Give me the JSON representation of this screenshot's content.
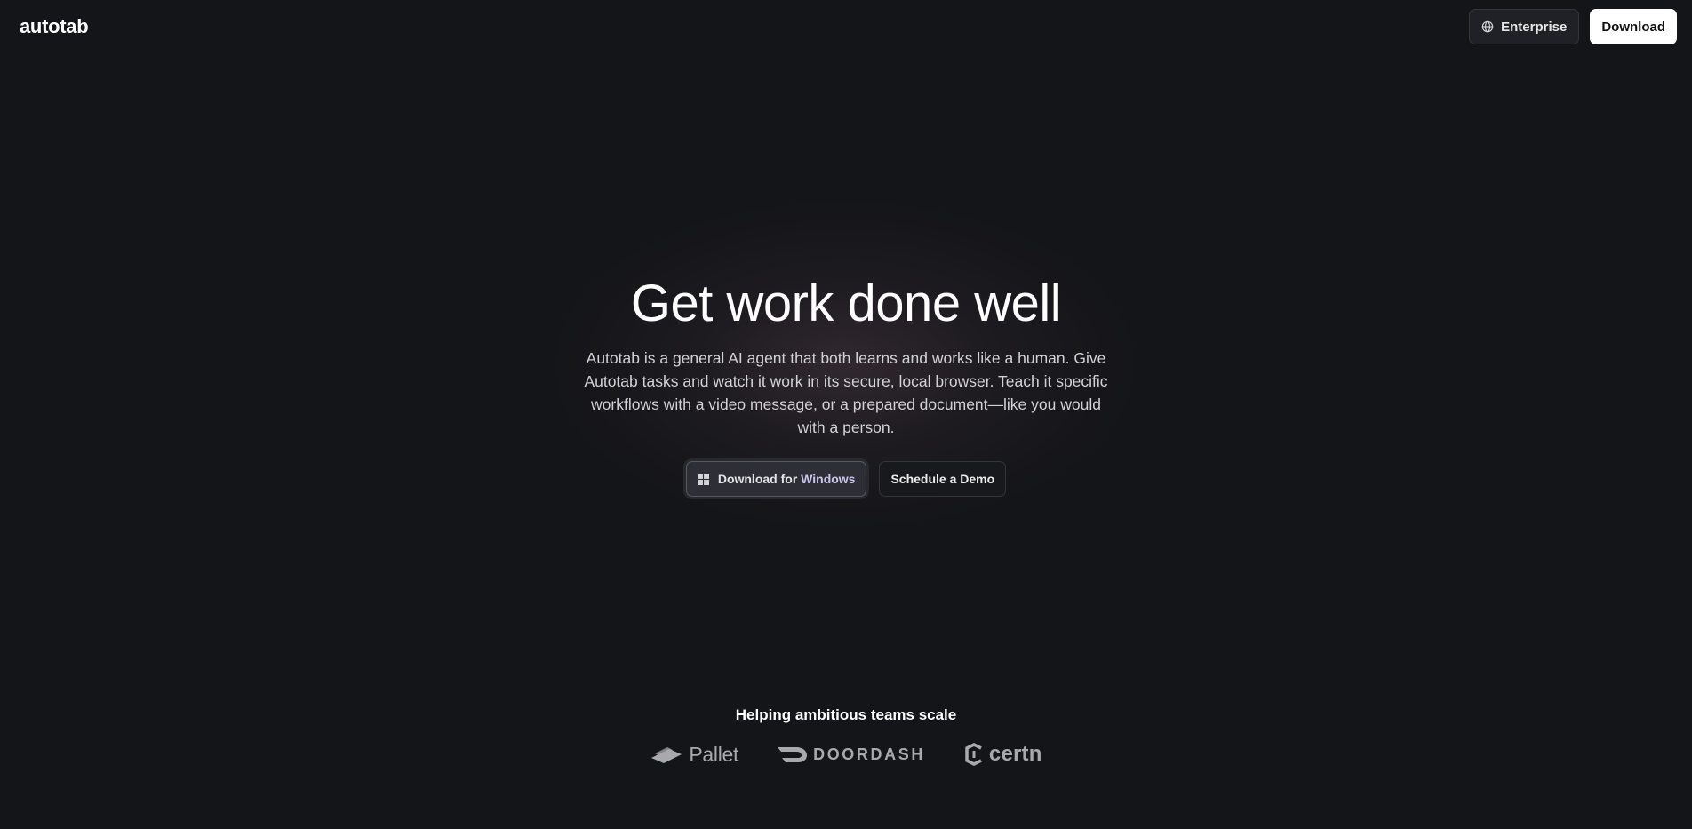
{
  "header": {
    "logo": "autotab",
    "enterprise_label": "Enterprise",
    "download_label": "Download"
  },
  "hero": {
    "title": "Get work done well",
    "description": "Autotab is a general AI agent that both learns and works like a human. Give Autotab tasks and watch it work in its secure, local browser. Teach it specific workflows with a video message, or a prepared document—like you would with a person.",
    "download_prefix": "Download for",
    "download_os": "Windows",
    "demo_label": "Schedule a Demo"
  },
  "logos": {
    "title": "Helping ambitious teams scale",
    "brands": [
      "Pallet",
      "DOORDASH",
      "certn"
    ]
  },
  "icons": {
    "enterprise": "globe-icon",
    "download_os": "windows-icon"
  },
  "colors": {
    "background": "#141518",
    "text": "#ffffff",
    "muted": "#a9a9ad",
    "accent_os": "#c9c7ec"
  }
}
